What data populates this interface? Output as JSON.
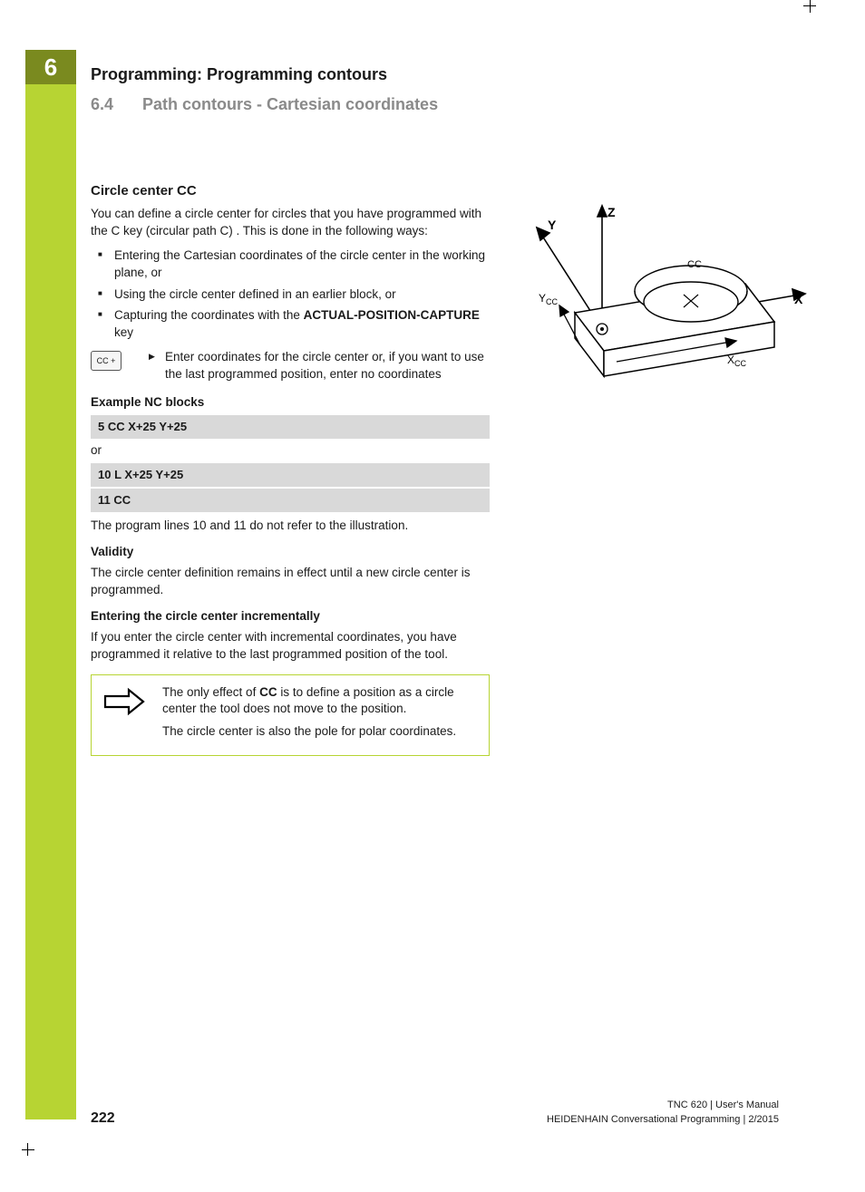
{
  "chapter": "6",
  "breadcrumb": "Programming: Programming contours",
  "section_num": "6.4",
  "section_title": "Path contours - Cartesian coordinates",
  "h3": "Circle center CC",
  "intro": "You can define a circle center for circles that you have programmed with the C key (circular path C) . This is done in the following ways:",
  "bullets": {
    "b1": "Entering the Cartesian coordinates of the circle center in the working plane, or",
    "b2": "Using the circle center defined in an earlier block, or",
    "b3_pre": "Capturing the coordinates with the ",
    "b3_bold": "ACTUAL-POSITION-CAPTURE",
    "b3_post": " key"
  },
  "key_label": "CC +",
  "key_desc": "Enter coordinates for the circle center or, if you want to use the last programmed position, enter no  coordinates",
  "example_head": "Example NC blocks",
  "code1": "5 CC X+25 Y+25",
  "or": "or",
  "code2": "10 L X+25 Y+25",
  "code3": "11 CC",
  "note_after_code": "The program lines 10 and 11 do not refer to the illustration.",
  "validity_head": "Validity",
  "validity_text": "The circle center definition remains in effect until a new circle center is programmed.",
  "incr_head": "Entering the circle center incrementally",
  "incr_text": "If you enter the circle center with incremental coordinates, you have programmed it relative to the last programmed position of the tool.",
  "notebox": {
    "p1_pre": "The only effect of ",
    "p1_bold": "CC",
    "p1_post": " is to define a position as a circle center  the tool does not move to the position.",
    "p2": "The circle center is also the pole for polar coordinates."
  },
  "diagram_labels": {
    "x": "X",
    "y": "Y",
    "z": "Z",
    "xcc": "X",
    "ycc": "Y",
    "cc": "CC"
  },
  "footer": {
    "page": "222",
    "line1": "TNC 620 | User's Manual",
    "line2": "HEIDENHAIN Conversational Programming | 2/2015"
  }
}
